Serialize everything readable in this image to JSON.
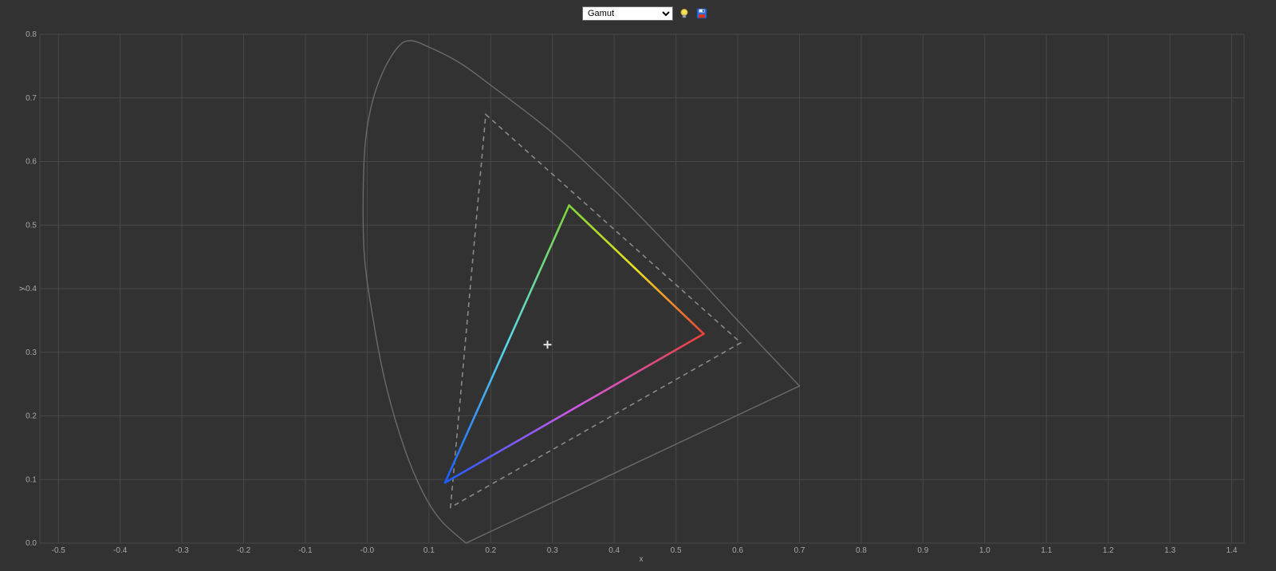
{
  "toolbar": {
    "mode_options": [
      "Gamut"
    ],
    "mode_selected": "Gamut",
    "bulb_icon": "lightbulb-icon",
    "save_icon": "floppy-disk-icon"
  },
  "colors": {
    "background": "#323232",
    "grid": "#484848",
    "locus": "#6a6a6a",
    "reference_gamut": "#8a8a8a",
    "red_primary": "#e8403a",
    "green_primary": "#7ed63a",
    "blue_primary": "#1a5cff",
    "white_point_marker": "#e6e6e6"
  },
  "chart_data": {
    "type": "scatter",
    "xlabel": "x",
    "ylabel": "y",
    "xlim": [
      -0.53,
      1.42
    ],
    "ylim": [
      0,
      0.8
    ],
    "grid": true,
    "x_ticks": [
      "-0.5",
      "-0.4",
      "-0.3",
      "-0.2",
      "-0.1",
      "-0.0",
      "0.1",
      "0.2",
      "0.3",
      "0.4",
      "0.5",
      "0.6",
      "0.7",
      "0.8",
      "0.9",
      "1.0",
      "1.1",
      "1.2",
      "1.3",
      "1.4"
    ],
    "x_tick_values": [
      -0.5,
      -0.4,
      -0.3,
      -0.2,
      -0.1,
      0.0,
      0.1,
      0.2,
      0.3,
      0.4,
      0.5,
      0.6,
      0.7,
      0.8,
      0.9,
      1.0,
      1.1,
      1.2,
      1.3,
      1.4
    ],
    "y_ticks": [
      "0.0",
      "0.1",
      "0.2",
      "0.3",
      "0.4",
      "0.5",
      "0.6",
      "0.7",
      "0.8"
    ],
    "y_tick_values": [
      0.0,
      0.1,
      0.2,
      0.3,
      0.4,
      0.5,
      0.6,
      0.7,
      0.8
    ],
    "spectral_locus": [
      [
        0.16,
        0.0
      ],
      [
        0.12,
        0.035
      ],
      [
        0.09,
        0.08
      ],
      [
        0.06,
        0.15
      ],
      [
        0.03,
        0.25
      ],
      [
        0.01,
        0.35
      ],
      [
        -0.005,
        0.46
      ],
      [
        -0.005,
        0.6
      ],
      [
        0.005,
        0.68
      ],
      [
        0.025,
        0.74
      ],
      [
        0.05,
        0.78
      ],
      [
        0.07,
        0.79
      ],
      [
        0.1,
        0.78
      ],
      [
        0.15,
        0.755
      ],
      [
        0.2,
        0.72
      ],
      [
        0.3,
        0.645
      ],
      [
        0.4,
        0.555
      ],
      [
        0.5,
        0.455
      ],
      [
        0.6,
        0.35
      ],
      [
        0.7,
        0.247
      ]
    ],
    "reference_gamut": [
      [
        0.192,
        0.674
      ],
      [
        0.605,
        0.315
      ],
      [
        0.135,
        0.056
      ]
    ],
    "measured_gamut": {
      "red": [
        0.545,
        0.329
      ],
      "green": [
        0.327,
        0.531
      ],
      "blue": [
        0.126,
        0.095
      ]
    },
    "white_point": [
      0.292,
      0.312
    ]
  }
}
